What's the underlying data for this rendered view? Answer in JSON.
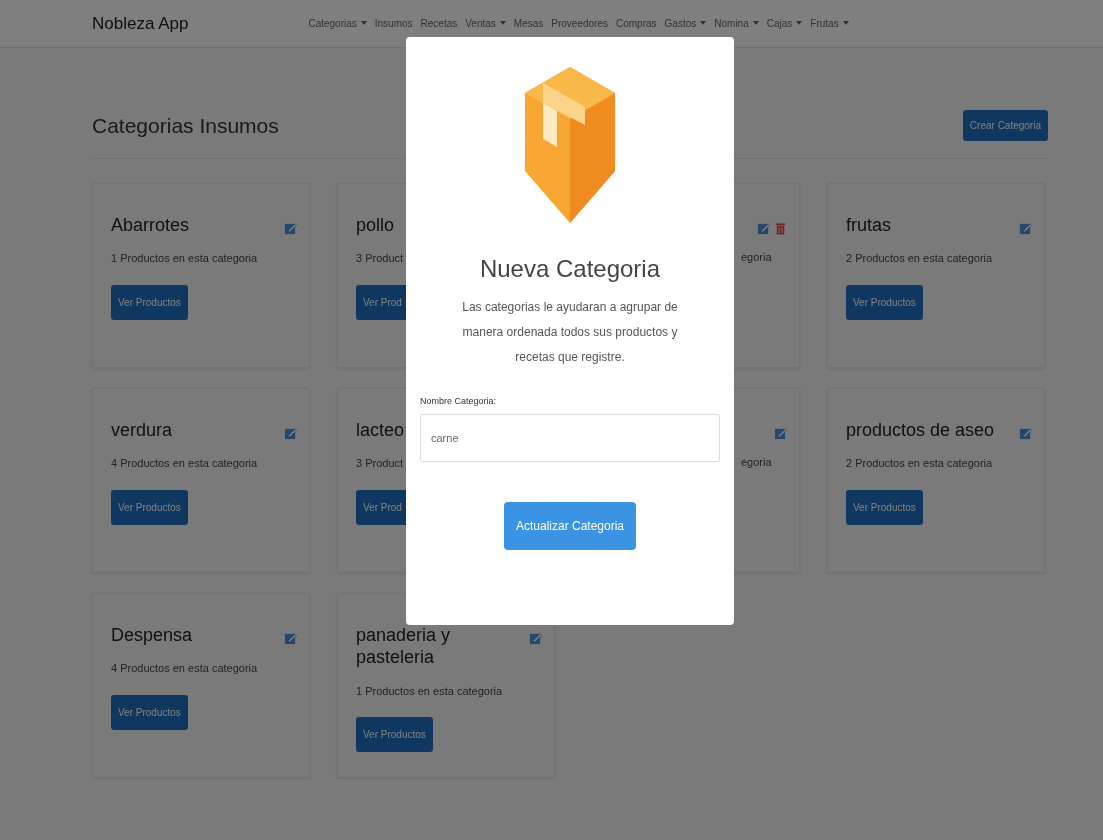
{
  "navbar": {
    "brand": "Nobleza App",
    "items": [
      {
        "label": "Categorias",
        "dropdown": true
      },
      {
        "label": "Insumos",
        "dropdown": false
      },
      {
        "label": "Recetas",
        "dropdown": false
      },
      {
        "label": "Ventas",
        "dropdown": true
      },
      {
        "label": "Mesas",
        "dropdown": false
      },
      {
        "label": "Proveedores",
        "dropdown": false
      },
      {
        "label": "Compras",
        "dropdown": false
      },
      {
        "label": "Gastos",
        "dropdown": true
      },
      {
        "label": "Nomina",
        "dropdown": true
      },
      {
        "label": "Cajas",
        "dropdown": true
      },
      {
        "label": "Frutas",
        "dropdown": true
      }
    ]
  },
  "page": {
    "title": "Categorias Insumos",
    "create_button": "Crear Categoria"
  },
  "cards": [
    {
      "title": "Abarrotes",
      "count": "1 Productos en esta categoria",
      "button": "Ver Productos",
      "editable": true,
      "deletable": false
    },
    {
      "title": "pollo",
      "count": "3 Product",
      "button": "Ver Prod",
      "editable": false,
      "deletable": false
    },
    {
      "count": "egoria",
      "editable": true,
      "deletable": true
    },
    {
      "title": "frutas",
      "count": "2 Productos en esta categoria",
      "button": "Ver Productos",
      "editable": true,
      "deletable": false
    },
    {
      "title": "verdura",
      "count": "4 Productos en esta categoria",
      "button": "Ver Productos",
      "editable": true,
      "deletable": false
    },
    {
      "title": "lacteo",
      "count": "3 Product",
      "button": "Ver Prod",
      "editable": false,
      "deletable": false
    },
    {
      "count": "egoria",
      "editable": true,
      "deletable": false
    },
    {
      "title": "productos de aseo",
      "count": "2 Productos en esta categoria",
      "button": "Ver Productos",
      "editable": true,
      "deletable": false
    },
    {
      "title": "Despensa",
      "count": "4 Productos en esta categoria",
      "button": "Ver Productos",
      "editable": true,
      "deletable": false
    },
    {
      "title": "panaderia y pasteleria",
      "count": "1 Productos en esta categoria",
      "button": "Ver Productos",
      "editable": true,
      "deletable": false
    }
  ],
  "modal": {
    "title": "Nueva Categoria",
    "text": "Las categorias le ayudaran a agrupar de manera ordenada todos sus productos y recetas que registre.",
    "field_label": "Nombre Categoria:",
    "field_value": "carne",
    "submit": "Actualizar Categoria"
  }
}
